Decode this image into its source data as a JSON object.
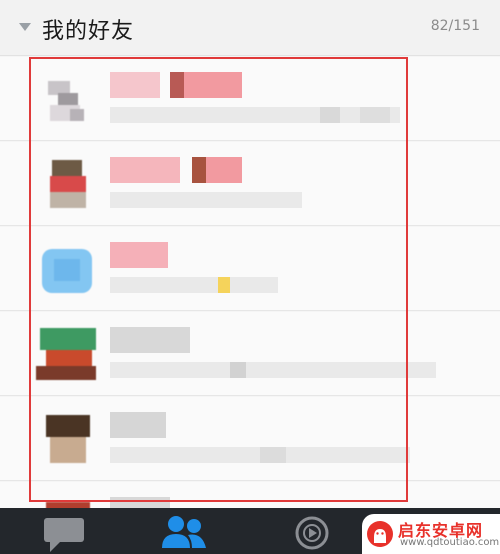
{
  "group": {
    "title": "我的好友",
    "count": "82/151"
  },
  "tabs": [
    {
      "name": "messages",
      "icon": "chat-bubble-icon",
      "active": false
    },
    {
      "name": "contacts",
      "icon": "contacts-icon",
      "active": true
    },
    {
      "name": "dynamic",
      "icon": "play-circle-icon",
      "active": false
    }
  ],
  "colors": {
    "header_bg": "#f2f2f2",
    "tabbar_bg": "#23272c",
    "active_tab": "#1f8ee8",
    "inactive_tab": "#8c8f94",
    "highlight": "#e03a3a",
    "watermark_red": "#e8312a"
  },
  "watermark": {
    "name": "启东安卓网",
    "url": "www.qdtoutiao.com"
  }
}
